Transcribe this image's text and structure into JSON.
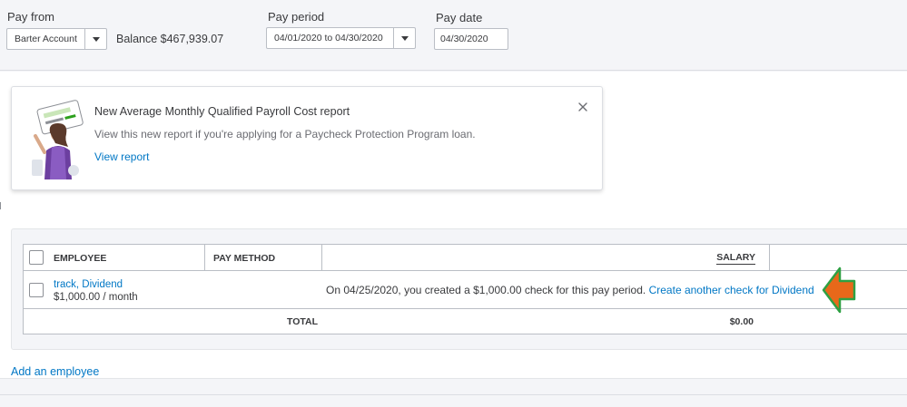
{
  "pay_from": {
    "label": "Pay from",
    "account": "Barter Account",
    "balance": "Balance $467,939.07"
  },
  "pay_period": {
    "label": "Pay period",
    "value": "04/01/2020 to 04/30/2020"
  },
  "pay_date": {
    "label": "Pay date",
    "value": "04/30/2020"
  },
  "notice": {
    "title": "New Average Monthly Qualified Payroll Cost report",
    "body": "View this new report if you're applying for a Paycheck Protection Program loan.",
    "link": "View report"
  },
  "table": {
    "headers": {
      "employee": "EMPLOYEE",
      "pay_method": "PAY METHOD",
      "salary": "SALARY"
    },
    "rows": [
      {
        "name": "track, Dividend",
        "rate": "$1,000.00 / month",
        "message": "On 04/25/2020, you created a $1,000.00 check for this pay period.",
        "link": "Create another check for Dividend"
      }
    ],
    "total_label": "TOTAL",
    "total_value": "$0.00"
  },
  "add_employee": "Add an employee",
  "colors": {
    "link": "#0077c5",
    "arrow_fill": "#e8681a",
    "arrow_stroke": "#2ea043"
  }
}
